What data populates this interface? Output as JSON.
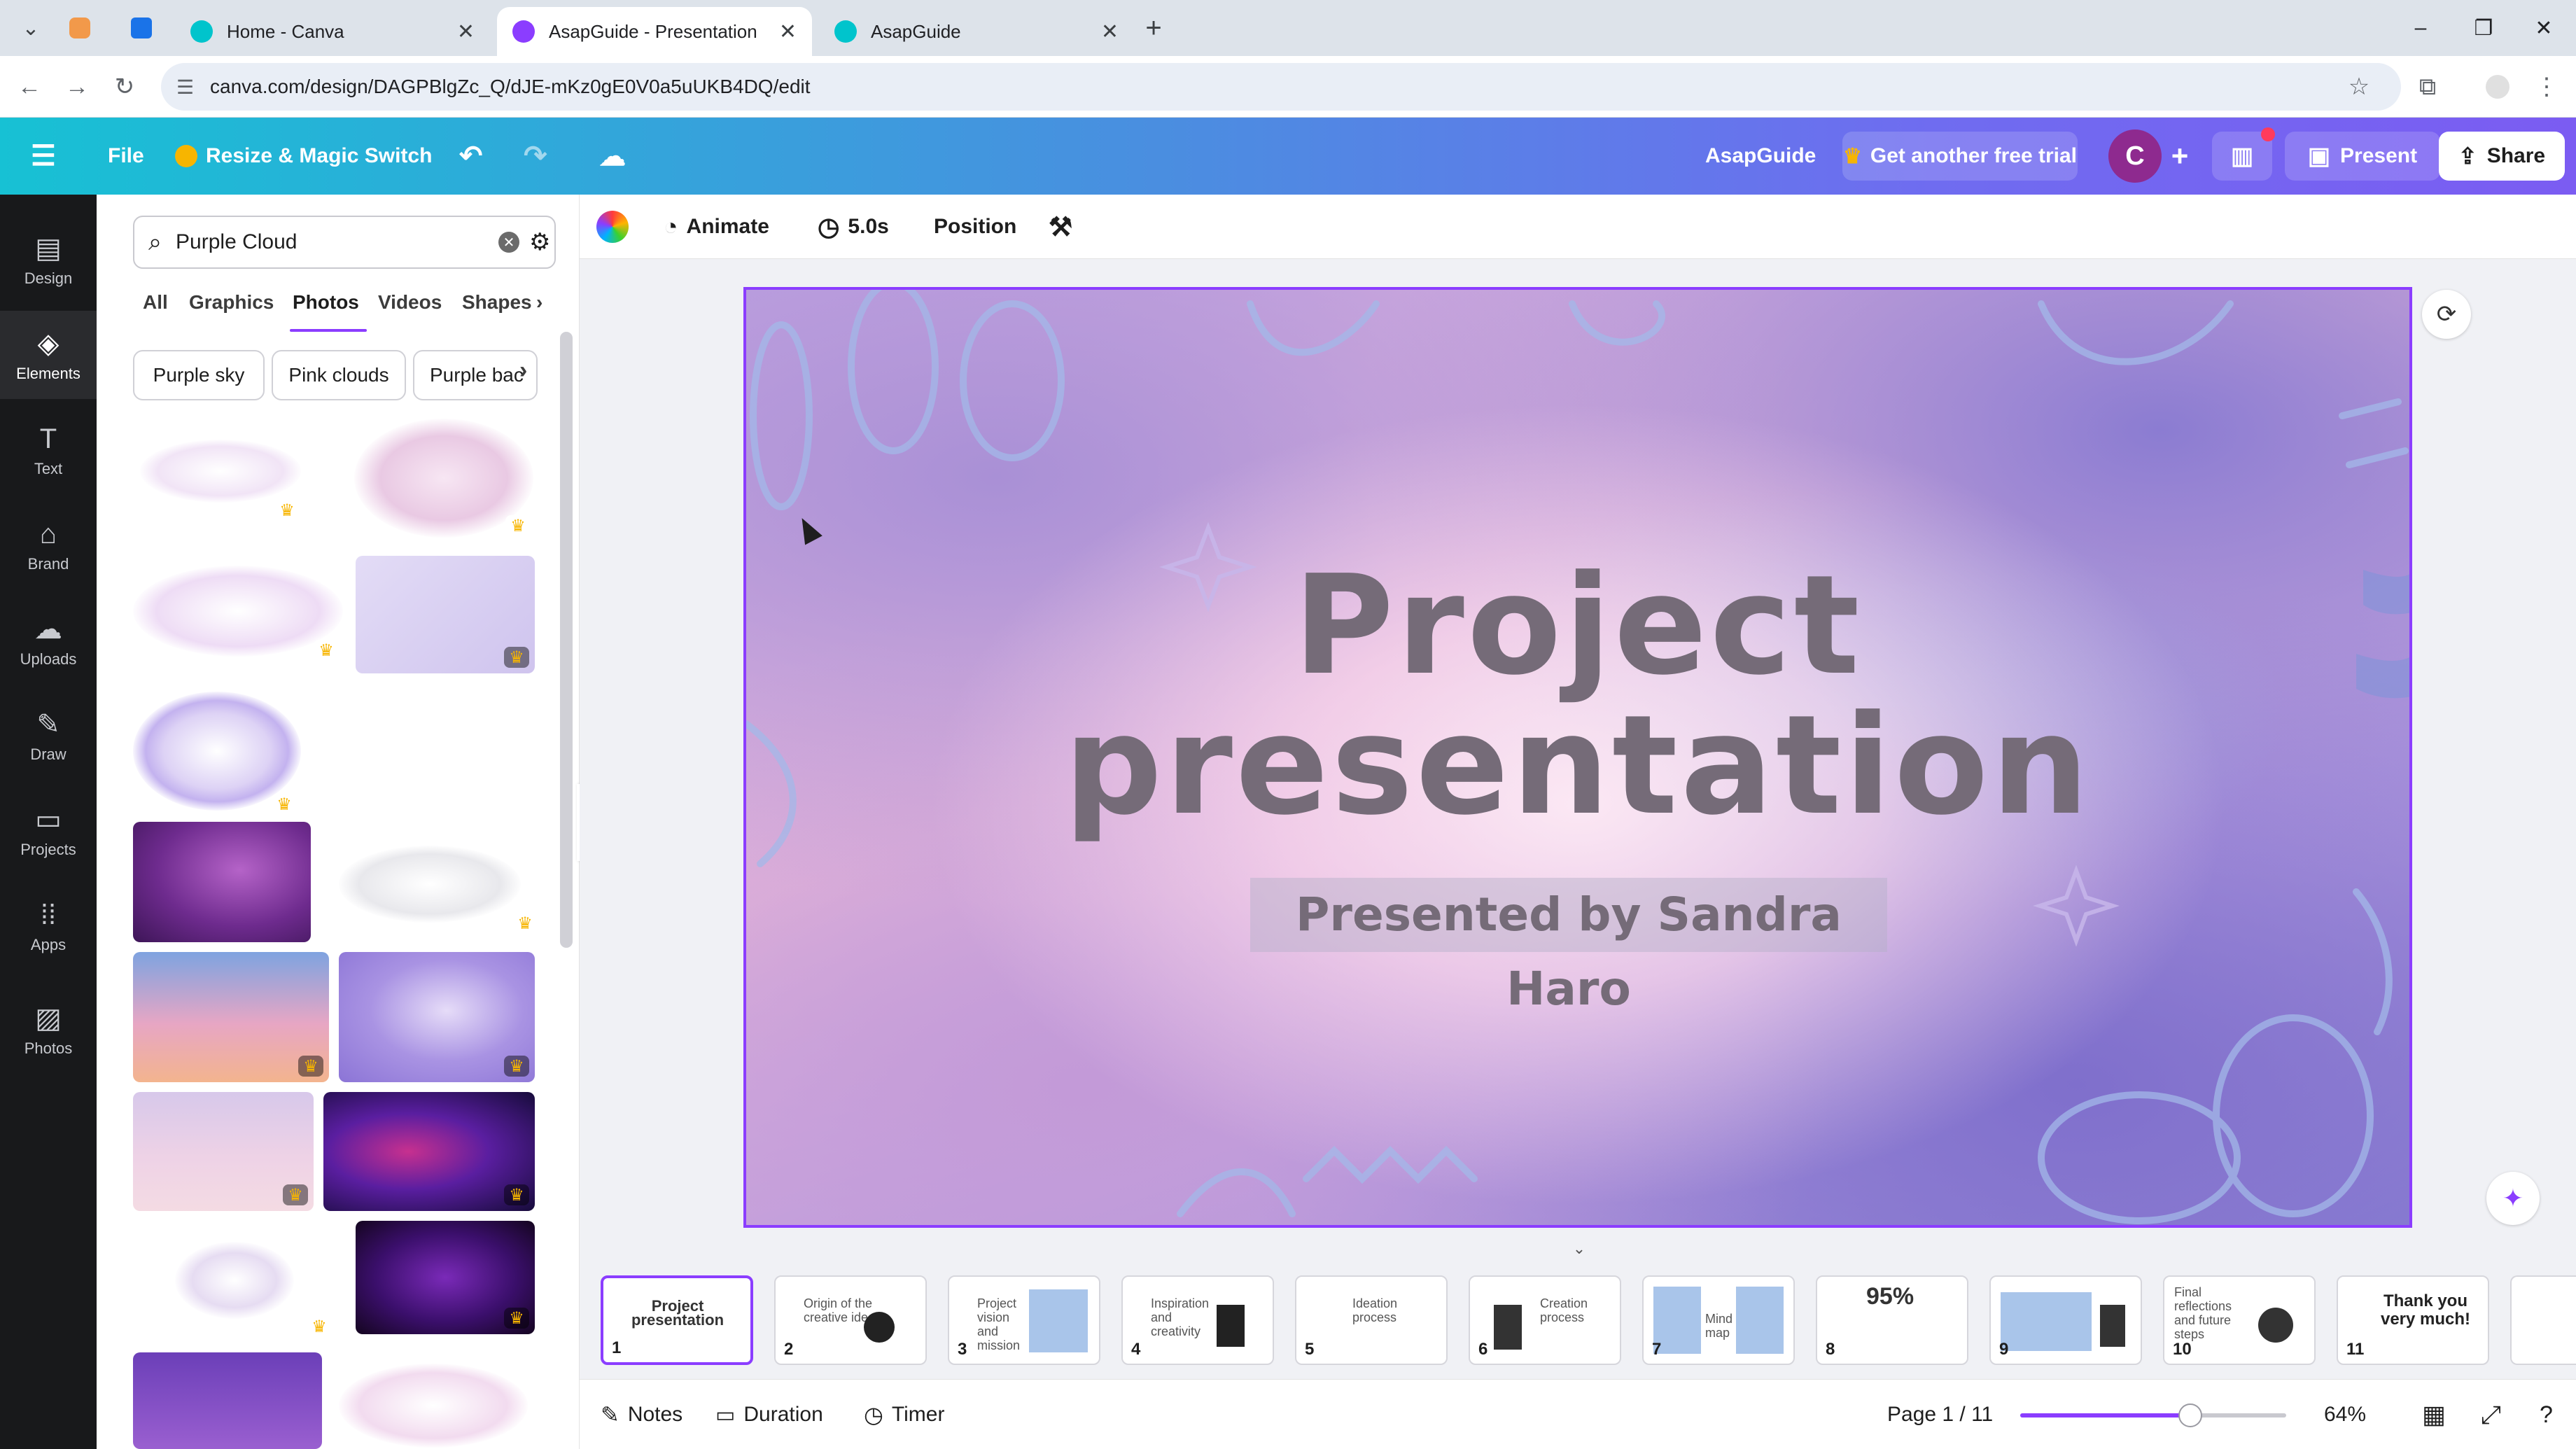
{
  "browser": {
    "tabs": [
      {
        "title": "Home - Canva",
        "active": false
      },
      {
        "title": "AsapGuide - Presentation",
        "active": true
      },
      {
        "title": "AsapGuide",
        "active": false
      }
    ],
    "url": "canva.com/design/DAGPBlgZc_Q/dJE-mKz0gE0V0a5uUKB4DQ/edit"
  },
  "header": {
    "file_label": "File",
    "resize_label": "Resize & Magic Switch",
    "doc_name": "AsapGuide",
    "trial_label": "Get another free trial",
    "avatar_letter": "C",
    "present_label": "Present",
    "share_label": "Share"
  },
  "rail": [
    {
      "label": "Design",
      "icon": "design-icon"
    },
    {
      "label": "Elements",
      "icon": "elements-icon"
    },
    {
      "label": "Text",
      "icon": "text-icon"
    },
    {
      "label": "Brand",
      "icon": "brand-icon"
    },
    {
      "label": "Uploads",
      "icon": "uploads-icon"
    },
    {
      "label": "Draw",
      "icon": "draw-icon"
    },
    {
      "label": "Projects",
      "icon": "projects-icon"
    },
    {
      "label": "Apps",
      "icon": "apps-icon"
    },
    {
      "label": "Photos",
      "icon": "photos-icon"
    }
  ],
  "panel": {
    "search_value": "Purple Cloud",
    "categories": [
      "All",
      "Graphics",
      "Photos",
      "Videos",
      "Shapes"
    ],
    "active_category": "Photos",
    "chips": [
      "Purple sky",
      "Pink clouds",
      "Purple bac"
    ]
  },
  "toolbar": {
    "animate_label": "Animate",
    "duration_value": "5.0s",
    "position_label": "Position"
  },
  "slide": {
    "title_line1": "Project",
    "title_line2": "presentation",
    "subtitle": "Presented by Sandra Haro"
  },
  "pages": [
    {
      "num": "1",
      "title": "Project presentation"
    },
    {
      "num": "2",
      "title": "Origin of the creative idea"
    },
    {
      "num": "3",
      "title": "Project vision and mission"
    },
    {
      "num": "4",
      "title": "Inspiration and creativity"
    },
    {
      "num": "5",
      "title": "Ideation process"
    },
    {
      "num": "6",
      "title": "Creation process"
    },
    {
      "num": "7",
      "title": "Mind map"
    },
    {
      "num": "8",
      "title": "95%"
    },
    {
      "num": "9",
      "title": ""
    },
    {
      "num": "10",
      "title": "Final reflections and future steps"
    },
    {
      "num": "11",
      "title": "Thank you very much!"
    }
  ],
  "footer": {
    "notes_label": "Notes",
    "duration_label": "Duration",
    "timer_label": "Timer",
    "page_indicator": "Page 1 / 11",
    "zoom_value": "64%",
    "zoom_level": 0.64
  },
  "colors": {
    "accent": "#8b3dff",
    "rail_bg": "#18191b",
    "crown": "#f7b500"
  }
}
